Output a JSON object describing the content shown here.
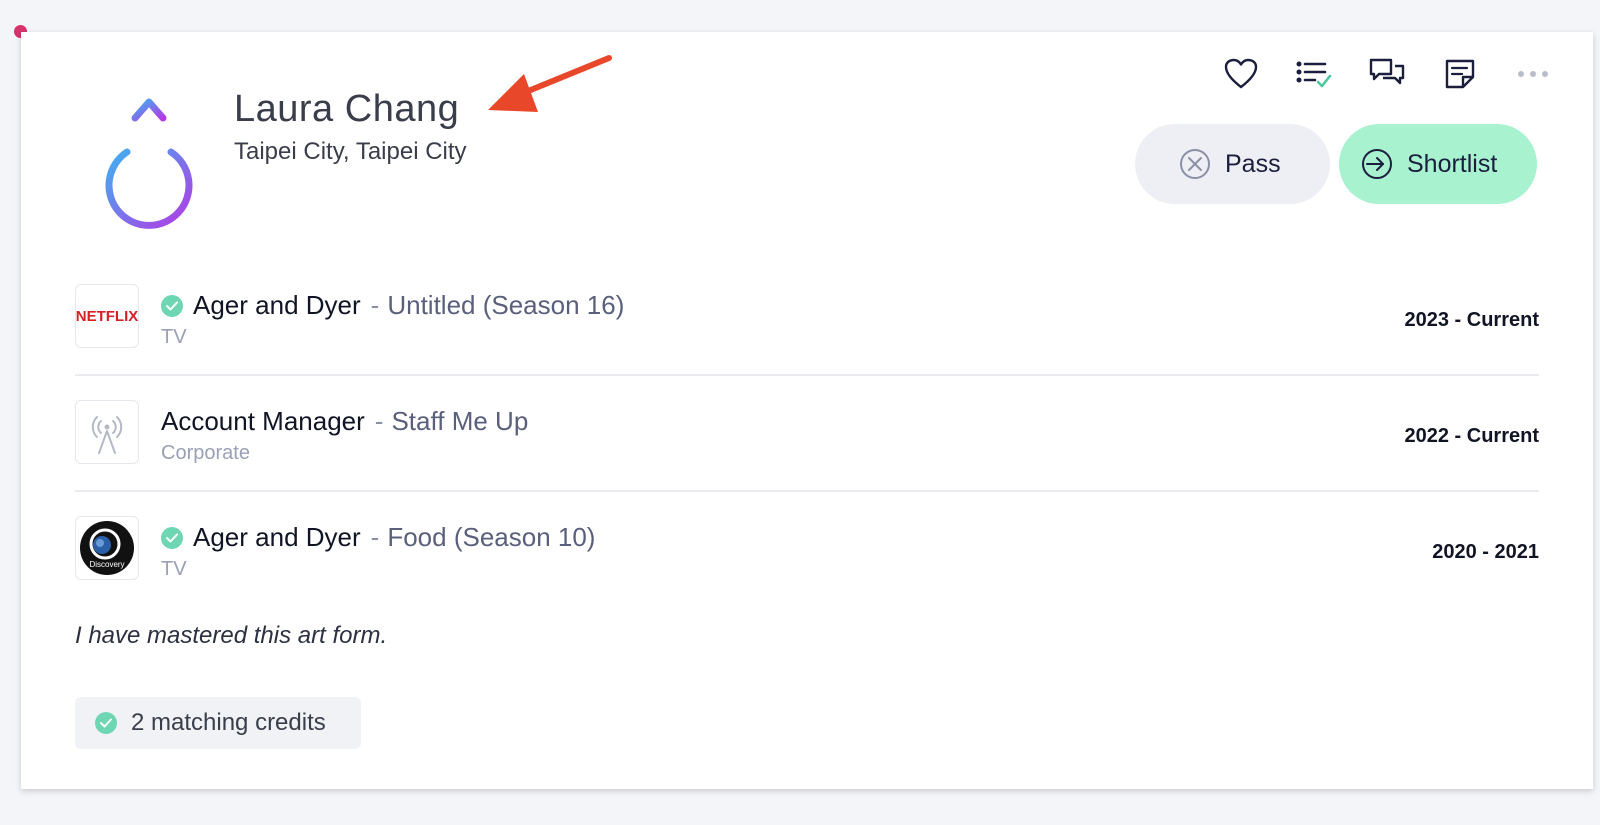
{
  "profile": {
    "name": "Laura Chang",
    "location": "Taipei City, Taipei City",
    "bio": "I have mastered this art form."
  },
  "toolbar": {
    "icons": [
      "heart-icon",
      "checklist-icon",
      "chat-bubbles-icon",
      "note-icon",
      "more-icon"
    ]
  },
  "actions": {
    "pass_label": "Pass",
    "shortlist_label": "Shortlist"
  },
  "credits": [
    {
      "logo": "NETFLIX",
      "verified": true,
      "title": "Ager and Dyer",
      "separator": "-",
      "project": "Untitled (Season 16)",
      "type": "TV",
      "dates": "2023 - Current"
    },
    {
      "logo": "antenna-icon",
      "verified": false,
      "title": "Account Manager",
      "separator": "-",
      "project": "Staff Me Up",
      "type": "Corporate",
      "dates": "2022 - Current"
    },
    {
      "logo": "Discovery",
      "verified": true,
      "title": "Ager and Dyer",
      "separator": "-",
      "project": "Food (Season 10)",
      "type": "TV",
      "dates": "2020 - 2021"
    }
  ],
  "matching": {
    "label": "2 matching credits"
  },
  "colors": {
    "accent_green": "#a8f2cf",
    "check_green": "#6fd6b4",
    "arrow_red": "#e8472a",
    "netflix_red": "#d81f26",
    "dot_pink": "#d6336c"
  }
}
